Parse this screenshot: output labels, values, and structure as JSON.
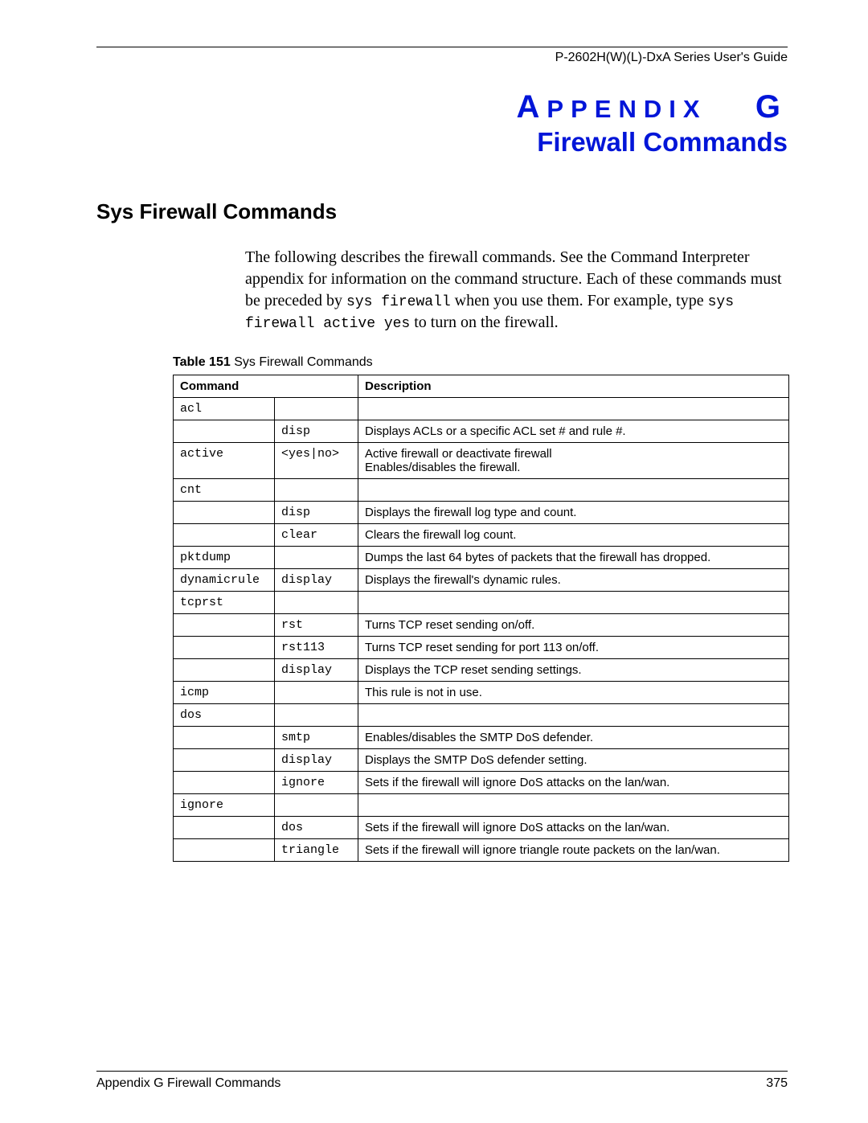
{
  "doc_header": "P-2602H(W)(L)-DxA Series User's Guide",
  "appendix": {
    "letter_prefix": "A",
    "letter_rest": "PPENDIX",
    "letter_suffix": "G",
    "title": "Firewall Commands"
  },
  "section_heading": "Sys Firewall Commands",
  "body": {
    "t1": "The following describes the firewall commands. See the Command Interpreter appendix for information on the command structure. Each of these commands must be preceded by ",
    "m1": "sys firewall",
    "t2": " when you use them. For example, type ",
    "m2": "sys firewall active yes",
    "t3": " to turn on the firewall."
  },
  "table_caption": {
    "bold": "Table 151",
    "rest": "   Sys Firewall Commands"
  },
  "headers": {
    "h1": "Command",
    "h2": "Description"
  },
  "rows": [
    {
      "c1": "acl",
      "c2": "",
      "desc": ""
    },
    {
      "c1": "",
      "c2": "disp",
      "desc": "Displays ACLs or a specific ACL set # and rule #."
    },
    {
      "c1": "active",
      "c2": "<yes|no>",
      "desc": "Active firewall or deactivate firewall\nEnables/disables the firewall."
    },
    {
      "c1": "cnt",
      "c2": "",
      "desc": ""
    },
    {
      "c1": "",
      "c2": "disp",
      "desc": "Displays the firewall log type and count."
    },
    {
      "c1": "",
      "c2": "clear",
      "desc": "Clears the firewall log count."
    },
    {
      "c1": "pktdump",
      "c2": "",
      "desc": "Dumps the last 64 bytes of packets that the firewall has dropped."
    },
    {
      "c1": "dynamicrule",
      "c2": "display",
      "desc": "Displays the firewall's dynamic rules."
    },
    {
      "c1": "tcprst",
      "c2": "",
      "desc": ""
    },
    {
      "c1": "",
      "c2": "rst",
      "desc": "Turns TCP reset sending on/off."
    },
    {
      "c1": "",
      "c2": "rst113",
      "desc": "Turns TCP reset sending for port 113 on/off."
    },
    {
      "c1": "",
      "c2": "display",
      "desc": "Displays the TCP reset sending settings."
    },
    {
      "c1": "icmp",
      "c2": "",
      "desc": "This rule is not in use."
    },
    {
      "c1": "dos",
      "c2": "",
      "desc": ""
    },
    {
      "c1": "",
      "c2": "smtp",
      "desc": "Enables/disables the SMTP DoS defender."
    },
    {
      "c1": "",
      "c2": "display",
      "desc": "Displays the SMTP DoS defender setting."
    },
    {
      "c1": "",
      "c2": "ignore",
      "desc": "Sets if the firewall will ignore DoS attacks on the lan/wan."
    },
    {
      "c1": "ignore",
      "c2": "",
      "desc": ""
    },
    {
      "c1": "",
      "c2": "dos",
      "desc": "Sets if the firewall will ignore DoS attacks on the lan/wan."
    },
    {
      "c1": "",
      "c2": "triangle",
      "desc": "Sets if the firewall will ignore triangle route packets on the lan/wan."
    }
  ],
  "footer": {
    "left": "Appendix G Firewall Commands",
    "right": "375"
  }
}
